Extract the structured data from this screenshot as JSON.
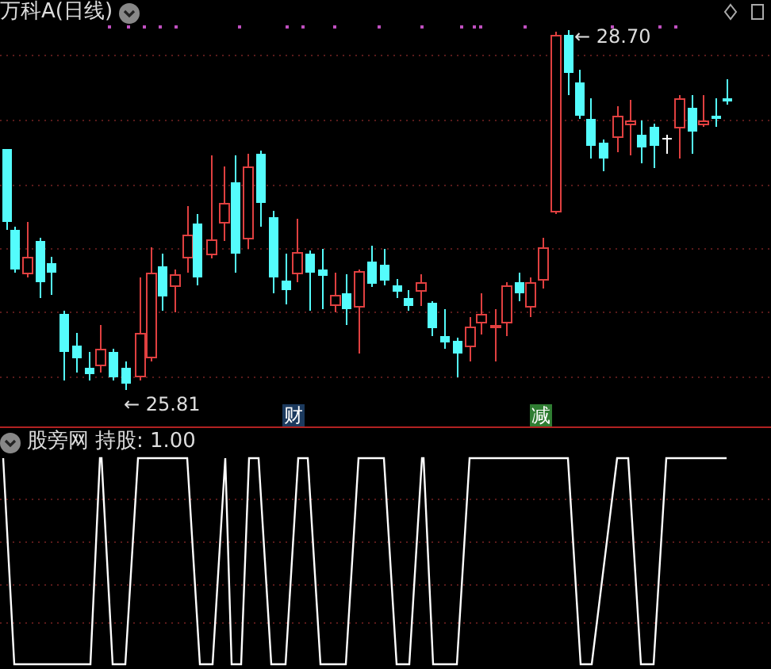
{
  "chart_title": "万科A(日线)",
  "high_label": "← 28.70",
  "low_label": "← 25.81",
  "event_markers": [
    {
      "text": "财",
      "color": "#1c3a5e"
    },
    {
      "text": "减",
      "color": "#2f7d32"
    }
  ],
  "indicator": {
    "name": "股旁网",
    "reading": "持股: 1.00"
  }
}
